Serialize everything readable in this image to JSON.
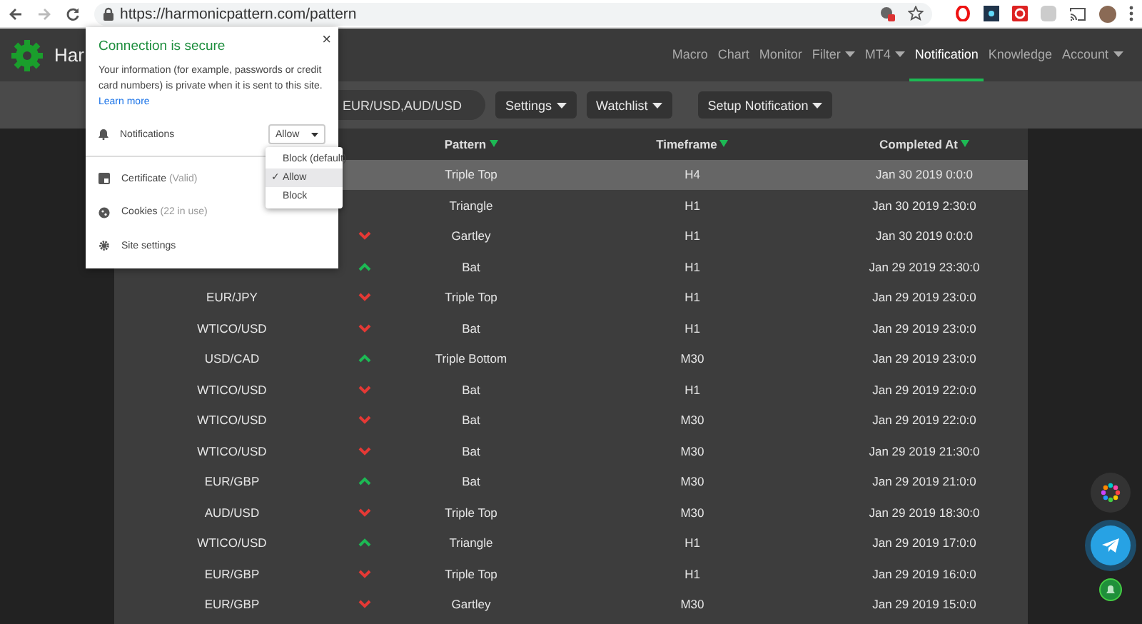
{
  "browser": {
    "url": "https://harmonicpattern.com/pattern"
  },
  "site": {
    "brand": "Har",
    "nav": [
      {
        "label": "Macro",
        "caret": false,
        "selected": false
      },
      {
        "label": "Chart",
        "caret": false,
        "selected": false
      },
      {
        "label": "Monitor",
        "caret": false,
        "selected": false
      },
      {
        "label": "Filter",
        "caret": true,
        "selected": false
      },
      {
        "label": "MT4",
        "caret": true,
        "selected": false
      },
      {
        "label": "Notification",
        "caret": false,
        "selected": true
      },
      {
        "label": "Knowledge",
        "caret": false,
        "selected": false
      },
      {
        "label": "Account",
        "caret": true,
        "selected": false
      }
    ]
  },
  "toolbar": {
    "search": {
      "value": "EUR/USD,AUD/USD"
    },
    "buttons": [
      "Settings",
      "Watchlist",
      "Setup Notification"
    ]
  },
  "table": {
    "columns": [
      "Pattern",
      "Timeframe",
      "Completed At"
    ],
    "rows": [
      {
        "pattern": "Triple Top",
        "timeframe": "H4",
        "completed": "Jan 30 2019 0:0:0",
        "selected": true
      },
      {
        "pattern": "Triangle",
        "timeframe": "H1",
        "completed": "Jan 30 2019 2:30:0",
        "selected": false
      },
      {
        "kind": "down",
        "pattern": "Gartley",
        "timeframe": "H1",
        "completed": "Jan 30 2019 0:0:0",
        "selected": false
      },
      {
        "kind": "up",
        "pattern": "Bat",
        "timeframe": "H1",
        "completed": "Jan 29 2019 23:30:0",
        "selected": false
      },
      {
        "symbol": "EUR/JPY",
        "kind": "down",
        "pattern": "Triple Top",
        "timeframe": "H1",
        "completed": "Jan 29 2019 23:0:0",
        "selected": false
      },
      {
        "symbol": "WTICO/USD",
        "kind": "down",
        "pattern": "Bat",
        "timeframe": "H1",
        "completed": "Jan 29 2019 23:0:0",
        "selected": false
      },
      {
        "symbol": "USD/CAD",
        "kind": "up",
        "pattern": "Triple Bottom",
        "timeframe": "M30",
        "completed": "Jan 29 2019 23:0:0",
        "selected": false
      },
      {
        "symbol": "WTICO/USD",
        "kind": "down",
        "pattern": "Bat",
        "timeframe": "H1",
        "completed": "Jan 29 2019 22:0:0",
        "selected": false
      },
      {
        "symbol": "WTICO/USD",
        "kind": "down",
        "pattern": "Bat",
        "timeframe": "M30",
        "completed": "Jan 29 2019 22:0:0",
        "selected": false
      },
      {
        "symbol": "WTICO/USD",
        "kind": "down",
        "pattern": "Bat",
        "timeframe": "M30",
        "completed": "Jan 29 2019 21:30:0",
        "selected": false
      },
      {
        "symbol": "EUR/GBP",
        "kind": "up",
        "pattern": "Bat",
        "timeframe": "M30",
        "completed": "Jan 29 2019 21:0:0",
        "selected": false
      },
      {
        "symbol": "AUD/USD",
        "kind": "down",
        "pattern": "Triple Top",
        "timeframe": "M30",
        "completed": "Jan 29 2019 18:30:0",
        "selected": false
      },
      {
        "symbol": "WTICO/USD",
        "kind": "up",
        "pattern": "Triangle",
        "timeframe": "H1",
        "completed": "Jan 29 2019 17:0:0",
        "selected": false
      },
      {
        "symbol": "EUR/GBP",
        "kind": "down",
        "pattern": "Triple Top",
        "timeframe": "H1",
        "completed": "Jan 29 2019 16:0:0",
        "selected": false
      },
      {
        "symbol": "EUR/GBP",
        "kind": "down",
        "pattern": "Gartley",
        "timeframe": "M30",
        "completed": "Jan 29 2019 15:0:0",
        "selected": false
      }
    ]
  },
  "site_info_popup": {
    "close": "×",
    "title": "Connection is secure",
    "message": "Your information (for example, passwords or credit card numbers) is private when it is sent to this site.",
    "link": "Learn more",
    "notifications": {
      "label": "Notifications",
      "value": "Allow",
      "check_mark": "✓",
      "options": [
        {
          "label": "Block (default)",
          "selected": false
        },
        {
          "label": "Allow",
          "selected": true
        },
        {
          "label": "Block",
          "selected": false
        }
      ]
    },
    "items": [
      {
        "kind": "certificate",
        "label": "Certificate",
        "note": "(Valid)"
      },
      {
        "kind": "cookies",
        "label": "Cookies",
        "note": "(22 in use)"
      },
      {
        "kind": "settings",
        "label": "Site settings"
      }
    ]
  }
}
